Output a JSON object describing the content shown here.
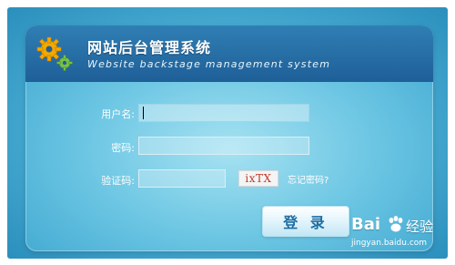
{
  "header": {
    "title": "网站后台管理系统",
    "subtitle": "Website backstage management system"
  },
  "form": {
    "username_label": "用户名:",
    "username_value": "",
    "password_label": "密码:",
    "password_value": "",
    "captcha_label": "验证码:",
    "captcha_value": "",
    "captcha_image_text": "ixTX",
    "forgot_link": "忘记密码?",
    "login_button": "登 录"
  },
  "watermark": {
    "brand_left": "Bai",
    "brand_right": "经验",
    "url": "jingyan.baidu.com"
  },
  "icons": {
    "gear_colors": [
      "#f2a900",
      "#7cc242"
    ]
  }
}
